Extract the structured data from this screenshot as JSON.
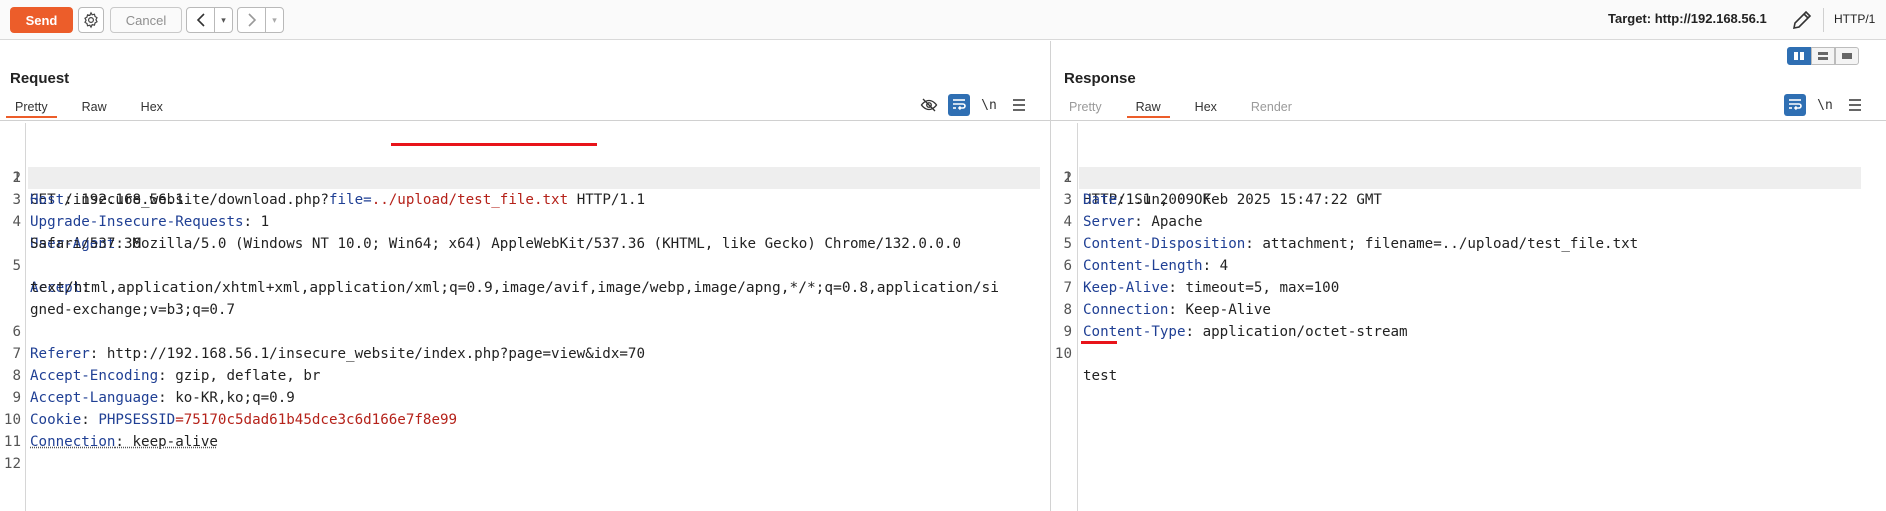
{
  "toolbar": {
    "send_label": "Send",
    "cancel_label": "Cancel",
    "target_label": "Target: http://192.168.56.1",
    "protocol_label": "HTTP/1",
    "back_arrow": "<",
    "forward_arrow": ">",
    "dropdown_glyph": "▾"
  },
  "request": {
    "title": "Request",
    "tabs": [
      "Pretty",
      "Raw",
      "Hex"
    ],
    "newline_toggle": "\\n",
    "line_numbers": [
      "1",
      "2",
      "3",
      "4",
      "",
      "5",
      "",
      "",
      "6",
      "7",
      "8",
      "9",
      "10",
      "11",
      "12"
    ],
    "lines": {
      "l1": {
        "method": "GET /insecure_website/download.php?",
        "param": "file=",
        "value": "../upload/test_file.txt",
        "tail": " HTTP/1.1"
      },
      "l2": {
        "key": "Host",
        "value": ": 192.168.56.1"
      },
      "l3": {
        "key": "Upgrade-Insecure-Requests",
        "value": ": 1"
      },
      "l4": {
        "key": "User-Agent",
        "value": ": Mozilla/5.0 (Windows NT 10.0; Win64; x64) AppleWebKit/537.36 (KHTML, like Gecko) Chrome/132.0.0.0"
      },
      "l4b": {
        "value": "Safari/537.36"
      },
      "l5": {
        "key": "Accept",
        "value": ":"
      },
      "l5b": {
        "value": "text/html,application/xhtml+xml,application/xml;q=0.9,image/avif,image/webp,image/apng,*/*;q=0.8,application/si"
      },
      "l5c": {
        "value": "gned-exchange;v=b3;q=0.7"
      },
      "l6": {
        "key": "Referer",
        "value": ": http://192.168.56.1/insecure_website/index.php?page=view&idx=70"
      },
      "l7": {
        "key": "Accept-Encoding",
        "value": ": gzip, deflate, br"
      },
      "l8": {
        "key": "Accept-Language",
        "value": ": ko-KR,ko;q=0.9"
      },
      "l9": {
        "key": "Cookie",
        "value_sep": ": ",
        "cookie_name": "PHPSESSID",
        "cookie_value": "=75170c5dad61b45dce3c6d166e7f8e99"
      },
      "l10": {
        "key": "Connection",
        "value": ": keep-alive"
      }
    }
  },
  "response": {
    "title": "Response",
    "tabs": [
      "Pretty",
      "Raw",
      "Hex",
      "Render"
    ],
    "newline_toggle": "\\n",
    "line_numbers": [
      "1",
      "2",
      "3",
      "4",
      "5",
      "6",
      "7",
      "8",
      "9",
      "10"
    ],
    "lines": {
      "l1": {
        "value": "HTTP/1.1 200 OK"
      },
      "l2": {
        "key": "Date",
        "value": ": Sun, 09 Feb 2025 15:47:22 GMT"
      },
      "l3": {
        "key": "Server",
        "value": ": Apache"
      },
      "l4": {
        "key": "Content-Disposition",
        "value": ": attachment; filename=../upload/test_file.txt"
      },
      "l5": {
        "key": "Content-Length",
        "value": ": 4"
      },
      "l6": {
        "key": "Keep-Alive",
        "value": ": timeout=5, max=100"
      },
      "l7": {
        "key": "Connection",
        "value": ": Keep-Alive"
      },
      "l8": {
        "key": "Content-Type",
        "value": ": application/octet-stream"
      },
      "l10": {
        "value": "test"
      }
    }
  },
  "colors": {
    "accent": "#ec5d2a",
    "header_key": "#1f3f94",
    "cookie": "#b5221a",
    "highlight_underline": "#e8141a",
    "toggle_active": "#2f6fb3"
  },
  "icons": [
    "gear-icon",
    "pencil-icon",
    "eye-off-icon",
    "wrap-lines-icon",
    "menu-icon",
    "layout-split-icon"
  ]
}
